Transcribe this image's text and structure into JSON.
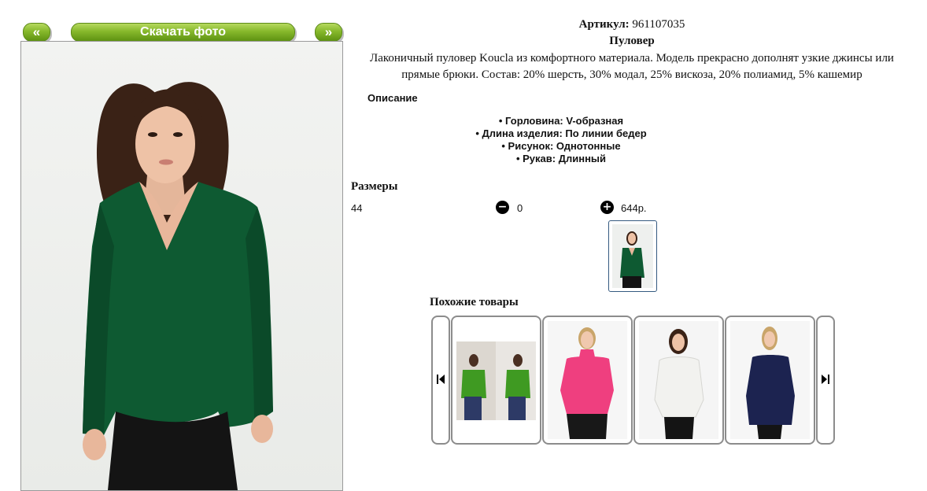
{
  "nav": {
    "prev_label": "«",
    "next_label": "»",
    "download_label": "Скачать фото"
  },
  "product": {
    "article_label": "Артикул:",
    "article_value": "961107035",
    "name": "Пуловер",
    "description": "Лаконичный пуловер Koucla из комфортного материала. Модель прекрасно дополнят узкие джинсы или прямые брюки. Состав: 20% шерсть, 30% модал, 25% вискоза, 20% полиамид, 5% кашемир",
    "main_photo_icon": "woman-green-sweater-photo"
  },
  "details": {
    "heading": "Описание",
    "attributes": [
      "• Горловина: V-образная",
      "• Длина изделия: По линии бедер",
      "• Рисунок: Однотонные",
      "• Рукав: Длинный"
    ]
  },
  "sizes": {
    "heading": "Размеры",
    "rows": [
      {
        "size": "44",
        "quantity": "0",
        "price": "644р."
      }
    ],
    "minus_icon": "minus-circle-icon",
    "plus_icon": "plus-circle-icon"
  },
  "similar": {
    "heading": "Похожие товары",
    "prev_icon": "skip-back-icon",
    "next_icon": "skip-forward-icon",
    "items": [
      {
        "icon": "green-turtleneck-photo",
        "color": "#3f9a22"
      },
      {
        "icon": "pink-sweater-photo",
        "color": "#ef3f7f"
      },
      {
        "icon": "white-sweater-photo",
        "color": "#f2f2ef"
      },
      {
        "icon": "navy-sweater-photo",
        "color": "#1c2350"
      }
    ]
  },
  "colors": {
    "button_green": "#86b82b",
    "sweater_green": "#0e5a32",
    "border_gray": "#8c8c8c"
  }
}
